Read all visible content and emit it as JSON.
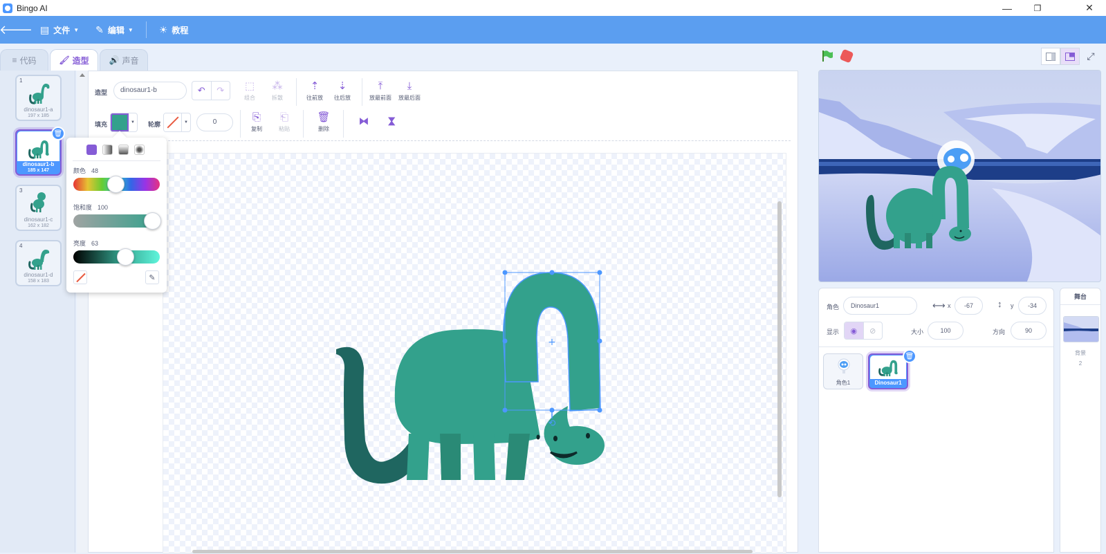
{
  "window": {
    "title": "Bingo AI",
    "minimize": "—",
    "maximize": "❐",
    "close": "✕"
  },
  "menubar": {
    "items": [
      {
        "label": "文件",
        "icon": "file-icon"
      },
      {
        "label": "编辑",
        "icon": "pencil-icon"
      },
      {
        "label": "教程",
        "icon": "lightbulb-icon"
      }
    ]
  },
  "tabs": [
    {
      "label": "代码",
      "icon": "code-icon",
      "active": false
    },
    {
      "label": "造型",
      "icon": "brush-icon",
      "active": true
    },
    {
      "label": "声音",
      "icon": "sound-icon",
      "active": false
    }
  ],
  "costumes": [
    {
      "num": "1",
      "name": "dinosaur1-a",
      "size": "197 x 185",
      "selected": false
    },
    {
      "num": "2",
      "name": "dinosaur1-b",
      "size": "185 x 147",
      "selected": true
    },
    {
      "num": "3",
      "name": "dinosaur1-c",
      "size": "162 x 182",
      "selected": false
    },
    {
      "num": "4",
      "name": "dinosaur1-d",
      "size": "158 x 183",
      "selected": false
    }
  ],
  "editor": {
    "costume_label": "造型",
    "costume_name": "dinosaur1-b",
    "tools": {
      "group": "组合",
      "ungroup": "拆散",
      "forward": "往前放",
      "backward": "往后放",
      "front": "放最前面",
      "back": "放最后面",
      "copy": "复制",
      "paste": "粘贴",
      "delete": "删除"
    },
    "fill_label": "填充",
    "outline_label": "轮廓",
    "stroke_width": "0",
    "fill_color": "#33a18c"
  },
  "color_popover": {
    "color_label": "颜色",
    "color_value": "48",
    "saturation_label": "饱和度",
    "saturation_value": "100",
    "brightness_label": "亮度",
    "brightness_value": "63"
  },
  "sprite_info": {
    "sprite_label": "角色",
    "sprite_name": "Dinosaur1",
    "x_label": "x",
    "x_value": "-67",
    "y_label": "y",
    "y_value": "-34",
    "show_label": "显示",
    "size_label": "大小",
    "size_value": "100",
    "direction_label": "方向",
    "direction_value": "90"
  },
  "sprites": [
    {
      "name": "角色1",
      "selected": false
    },
    {
      "name": "Dinosaur1",
      "selected": true
    }
  ],
  "stage_pane": {
    "title": "舞台",
    "backdrop_label": "背景",
    "backdrop_count": "2"
  },
  "colors": {
    "accent": "#855cd6",
    "menubar": "#5b9ef0",
    "dino": "#33a18c",
    "dino_dark": "#1f6660"
  }
}
